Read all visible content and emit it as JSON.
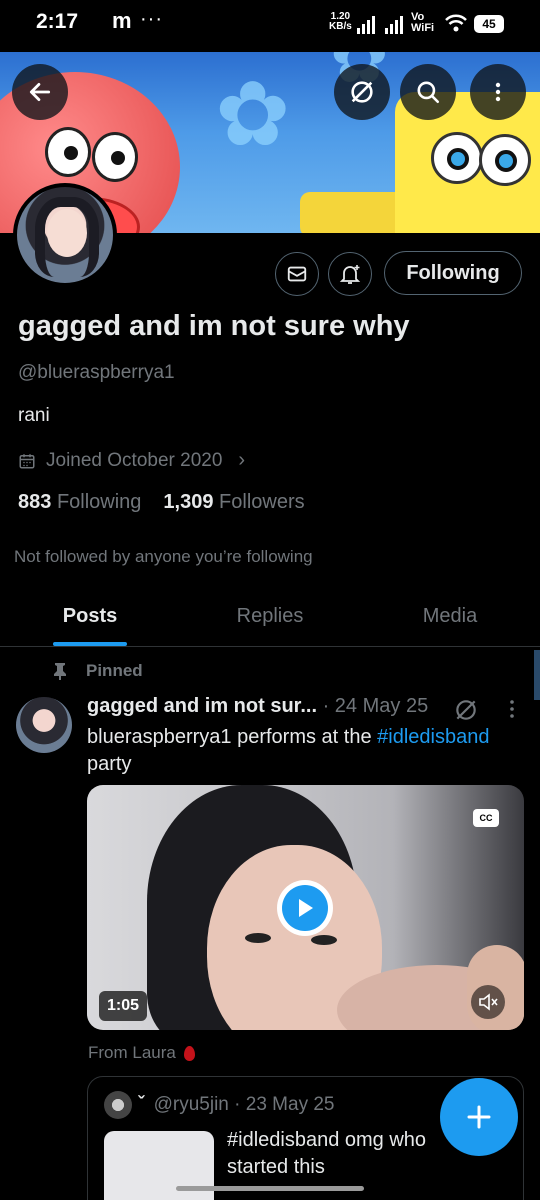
{
  "status_bar": {
    "time": "2:17",
    "extra": "m",
    "dots": "···",
    "speed_value": "1.20",
    "speed_unit": "KB/s",
    "vo": "Vo",
    "wifi": "WiFi",
    "battery": "45"
  },
  "banner": {
    "back_icon": "arrow-left-icon",
    "grok_icon": "grok-icon",
    "search_icon": "search-icon",
    "more_icon": "more-vertical-icon"
  },
  "profile": {
    "display_name": "gagged and im not sure why",
    "handle": "@blueraspberrya1",
    "bio": "rani",
    "joined": "Joined October 2020",
    "following_count": "883",
    "following_label": "Following",
    "followers_count": "1,309",
    "followers_label": "Followers",
    "not_followed_text": "Not followed by anyone you’re following",
    "follow_button": "Following"
  },
  "tabs": [
    {
      "label": "Posts",
      "active": true
    },
    {
      "label": "Replies",
      "active": false
    },
    {
      "label": "Media",
      "active": false
    }
  ],
  "pinned_post": {
    "pinned_label": "Pinned",
    "author_name": "gagged and im not sur...",
    "date": "· 24 May 25",
    "text_before": "blueraspberrya1 performs at the ",
    "hashtag": "#idledisband",
    "text_after": "party",
    "video_duration": "1:05",
    "cc_label": "CC",
    "from_text": "From Laura"
  },
  "quoted_post": {
    "caret": "ˇ",
    "handle": "@ryu5jin",
    "date": "· 23 May 25",
    "text": "#idledisband omg who started this"
  },
  "colors": {
    "accent": "#1d9bf0",
    "background": "#000000",
    "text_primary": "#e7e9ea",
    "text_secondary": "#71767b",
    "border": "#2f3336"
  }
}
